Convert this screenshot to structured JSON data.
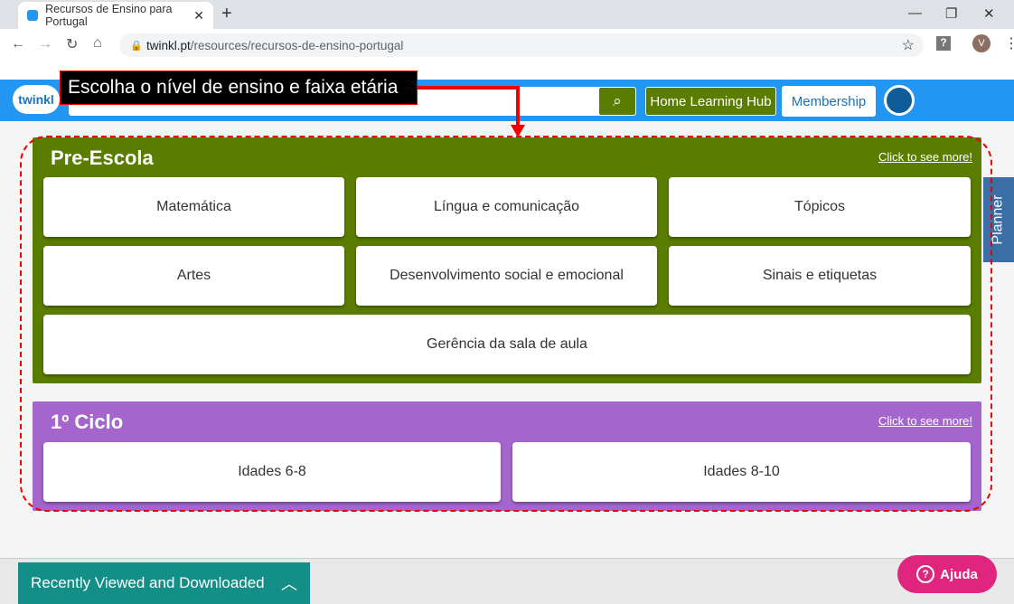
{
  "browser": {
    "tab_title": "Recursos de Ensino para Portugal",
    "url_domain": "twinkl.pt",
    "url_path": "/resources/recursos-de-ensino-portugal",
    "profile_initial": "V"
  },
  "header": {
    "logo": "twinkl",
    "home_learning_hub": "Home Learning Hub",
    "membership": "Membership"
  },
  "annotation": {
    "text": "Escolha o nível de ensino e faixa etária",
    "color": "#ee0000"
  },
  "sections": [
    {
      "title": "Pre-Escola",
      "more": "Click to see more!",
      "color": "#5a7d00",
      "cards": [
        "Matemática",
        "Língua e comunicação",
        "Tópicos",
        "Artes",
        "Desenvolvimento social e emocional",
        "Sinais e etiquetas",
        "Gerência da sala de aula"
      ]
    },
    {
      "title": "1º Ciclo",
      "more": "Click to see more!",
      "color": "#a466cc",
      "cards": [
        "Idades 6-8",
        "Idades 8-10"
      ]
    }
  ],
  "planner": "Planner",
  "recent": "Recently Viewed and Downloaded",
  "help": "Ajuda"
}
